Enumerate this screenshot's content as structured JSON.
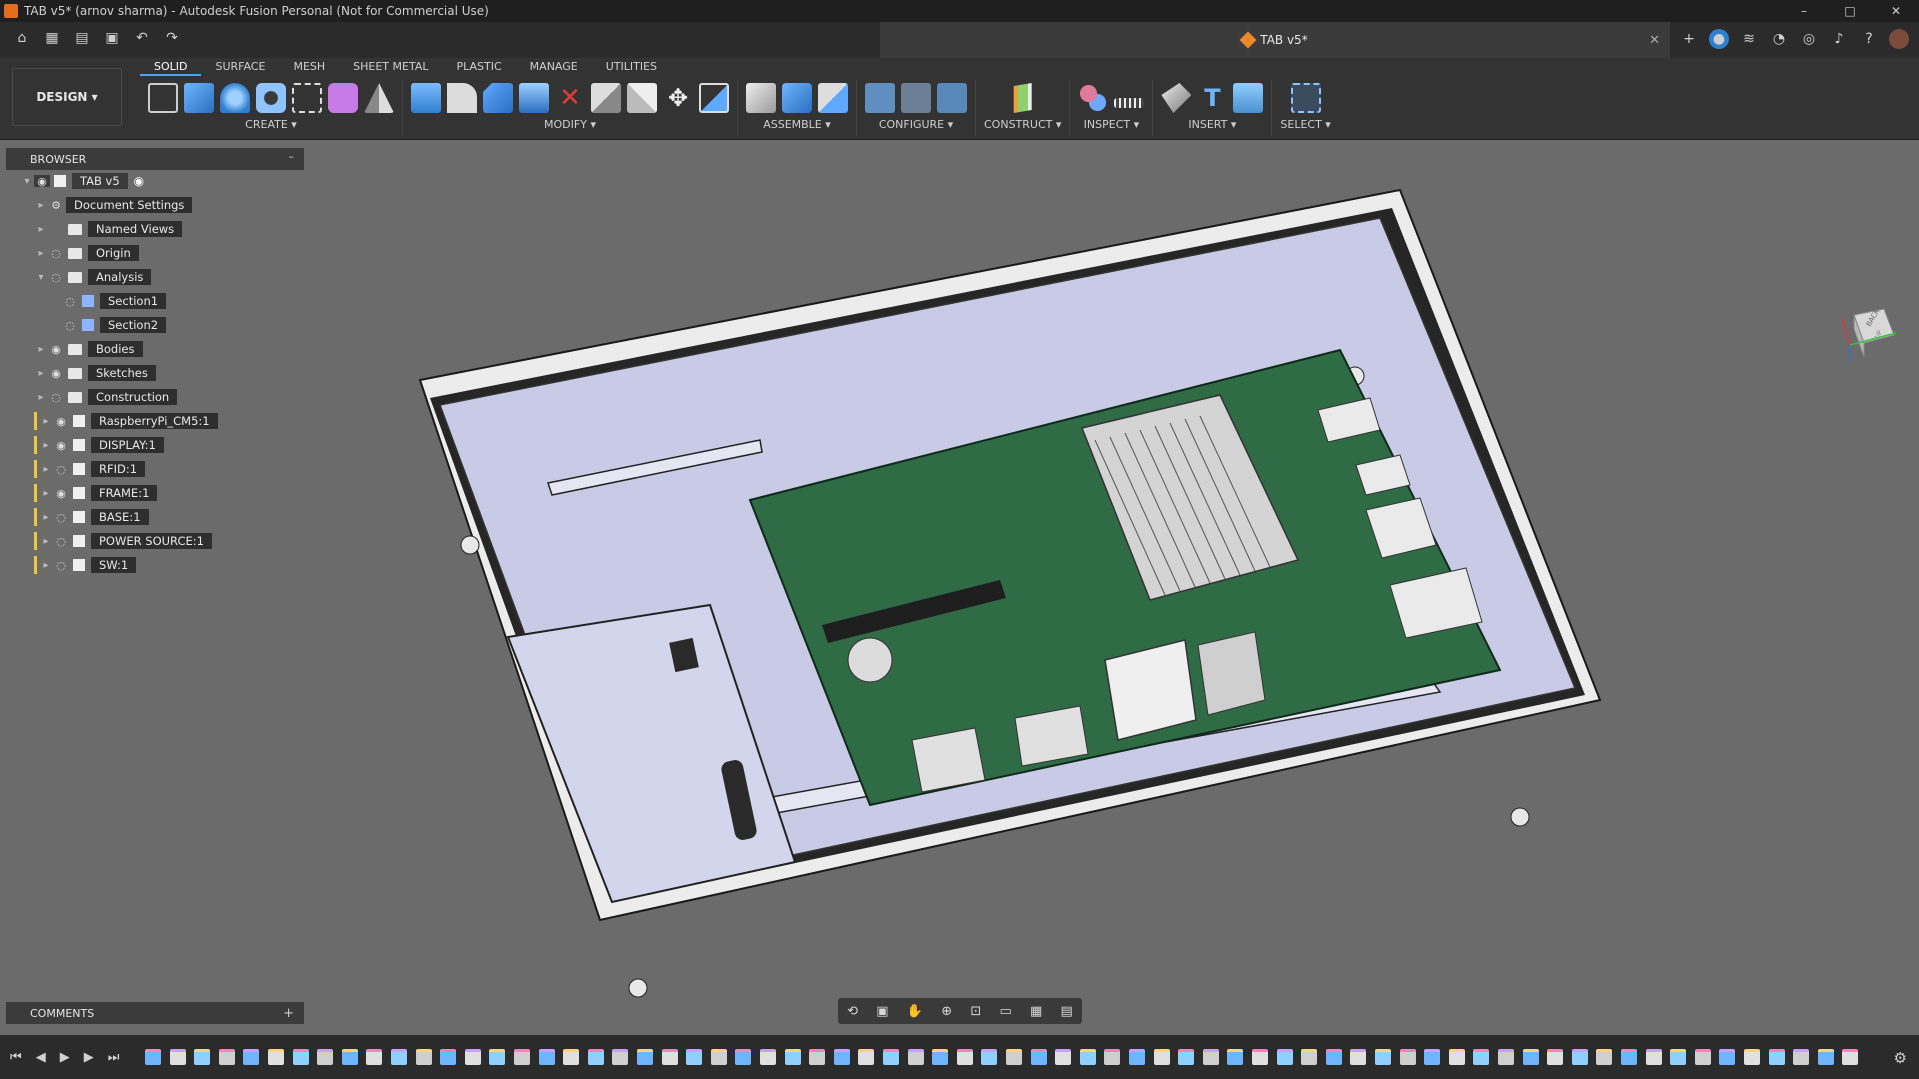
{
  "window": {
    "title": "TAB v5* (arnov sharma) - Autodesk Fusion Personal (Not for Commercial Use)",
    "controls": [
      "–",
      "□",
      "✕"
    ]
  },
  "document_tab": {
    "name": "TAB v5*"
  },
  "workspace_button": {
    "label": "DESIGN ▾"
  },
  "ribbon": {
    "tabs": [
      "SOLID",
      "SURFACE",
      "MESH",
      "SHEET METAL",
      "PLASTIC",
      "MANAGE",
      "UTILITIES"
    ],
    "active_tab": "SOLID",
    "groups": [
      {
        "label": "CREATE ▾",
        "icon_count": 6
      },
      {
        "label": "MODIFY ▾",
        "icon_count": 9
      },
      {
        "label": "ASSEMBLE ▾",
        "icon_count": 3
      },
      {
        "label": "CONFIGURE ▾",
        "icon_count": 3
      },
      {
        "label": "CONSTRUCT ▾",
        "icon_count": 1
      },
      {
        "label": "INSPECT ▾",
        "icon_count": 2
      },
      {
        "label": "INSERT ▾",
        "icon_count": 3
      },
      {
        "label": "SELECT ▾",
        "icon_count": 1
      }
    ]
  },
  "browser": {
    "title": "BROWSER",
    "root": "TAB v5",
    "items": [
      {
        "label": "Document Settings",
        "kind": "settings",
        "depth": 1,
        "visible": null
      },
      {
        "label": "Named Views",
        "kind": "folder",
        "depth": 1,
        "visible": null
      },
      {
        "label": "Origin",
        "kind": "folder",
        "depth": 1,
        "visible": false
      },
      {
        "label": "Analysis",
        "kind": "folder",
        "depth": 1,
        "visible": false,
        "expanded": true
      },
      {
        "label": "Section1",
        "kind": "section",
        "depth": 2,
        "visible": false
      },
      {
        "label": "Section2",
        "kind": "section",
        "depth": 2,
        "visible": false
      },
      {
        "label": "Bodies",
        "kind": "folder",
        "depth": 1,
        "visible": true
      },
      {
        "label": "Sketches",
        "kind": "folder",
        "depth": 1,
        "visible": true
      },
      {
        "label": "Construction",
        "kind": "folder",
        "depth": 1,
        "visible": false
      },
      {
        "label": "RaspberryPi_CM5:1",
        "kind": "component",
        "depth": 1,
        "visible": true
      },
      {
        "label": "DISPLAY:1",
        "kind": "component",
        "depth": 1,
        "visible": true
      },
      {
        "label": "RFID:1",
        "kind": "component",
        "depth": 1,
        "visible": false
      },
      {
        "label": "FRAME:1",
        "kind": "component",
        "depth": 1,
        "visible": true
      },
      {
        "label": "BASE:1",
        "kind": "component",
        "depth": 1,
        "visible": false
      },
      {
        "label": "POWER SOURCE:1",
        "kind": "component",
        "depth": 1,
        "visible": false
      },
      {
        "label": "SW:1",
        "kind": "component",
        "depth": 1,
        "visible": false
      }
    ]
  },
  "comments": {
    "title": "COMMENTS"
  },
  "viewcube": {
    "faces": [
      "BACK",
      "UP"
    ]
  },
  "colors": {
    "viewport_bg": "#6b6b6b",
    "enclosure_floor": "#c9cbe6",
    "pcb": "#2f6b45",
    "accent_blue": "#4aa3ff"
  },
  "timeline": {
    "feature_count": 70
  }
}
